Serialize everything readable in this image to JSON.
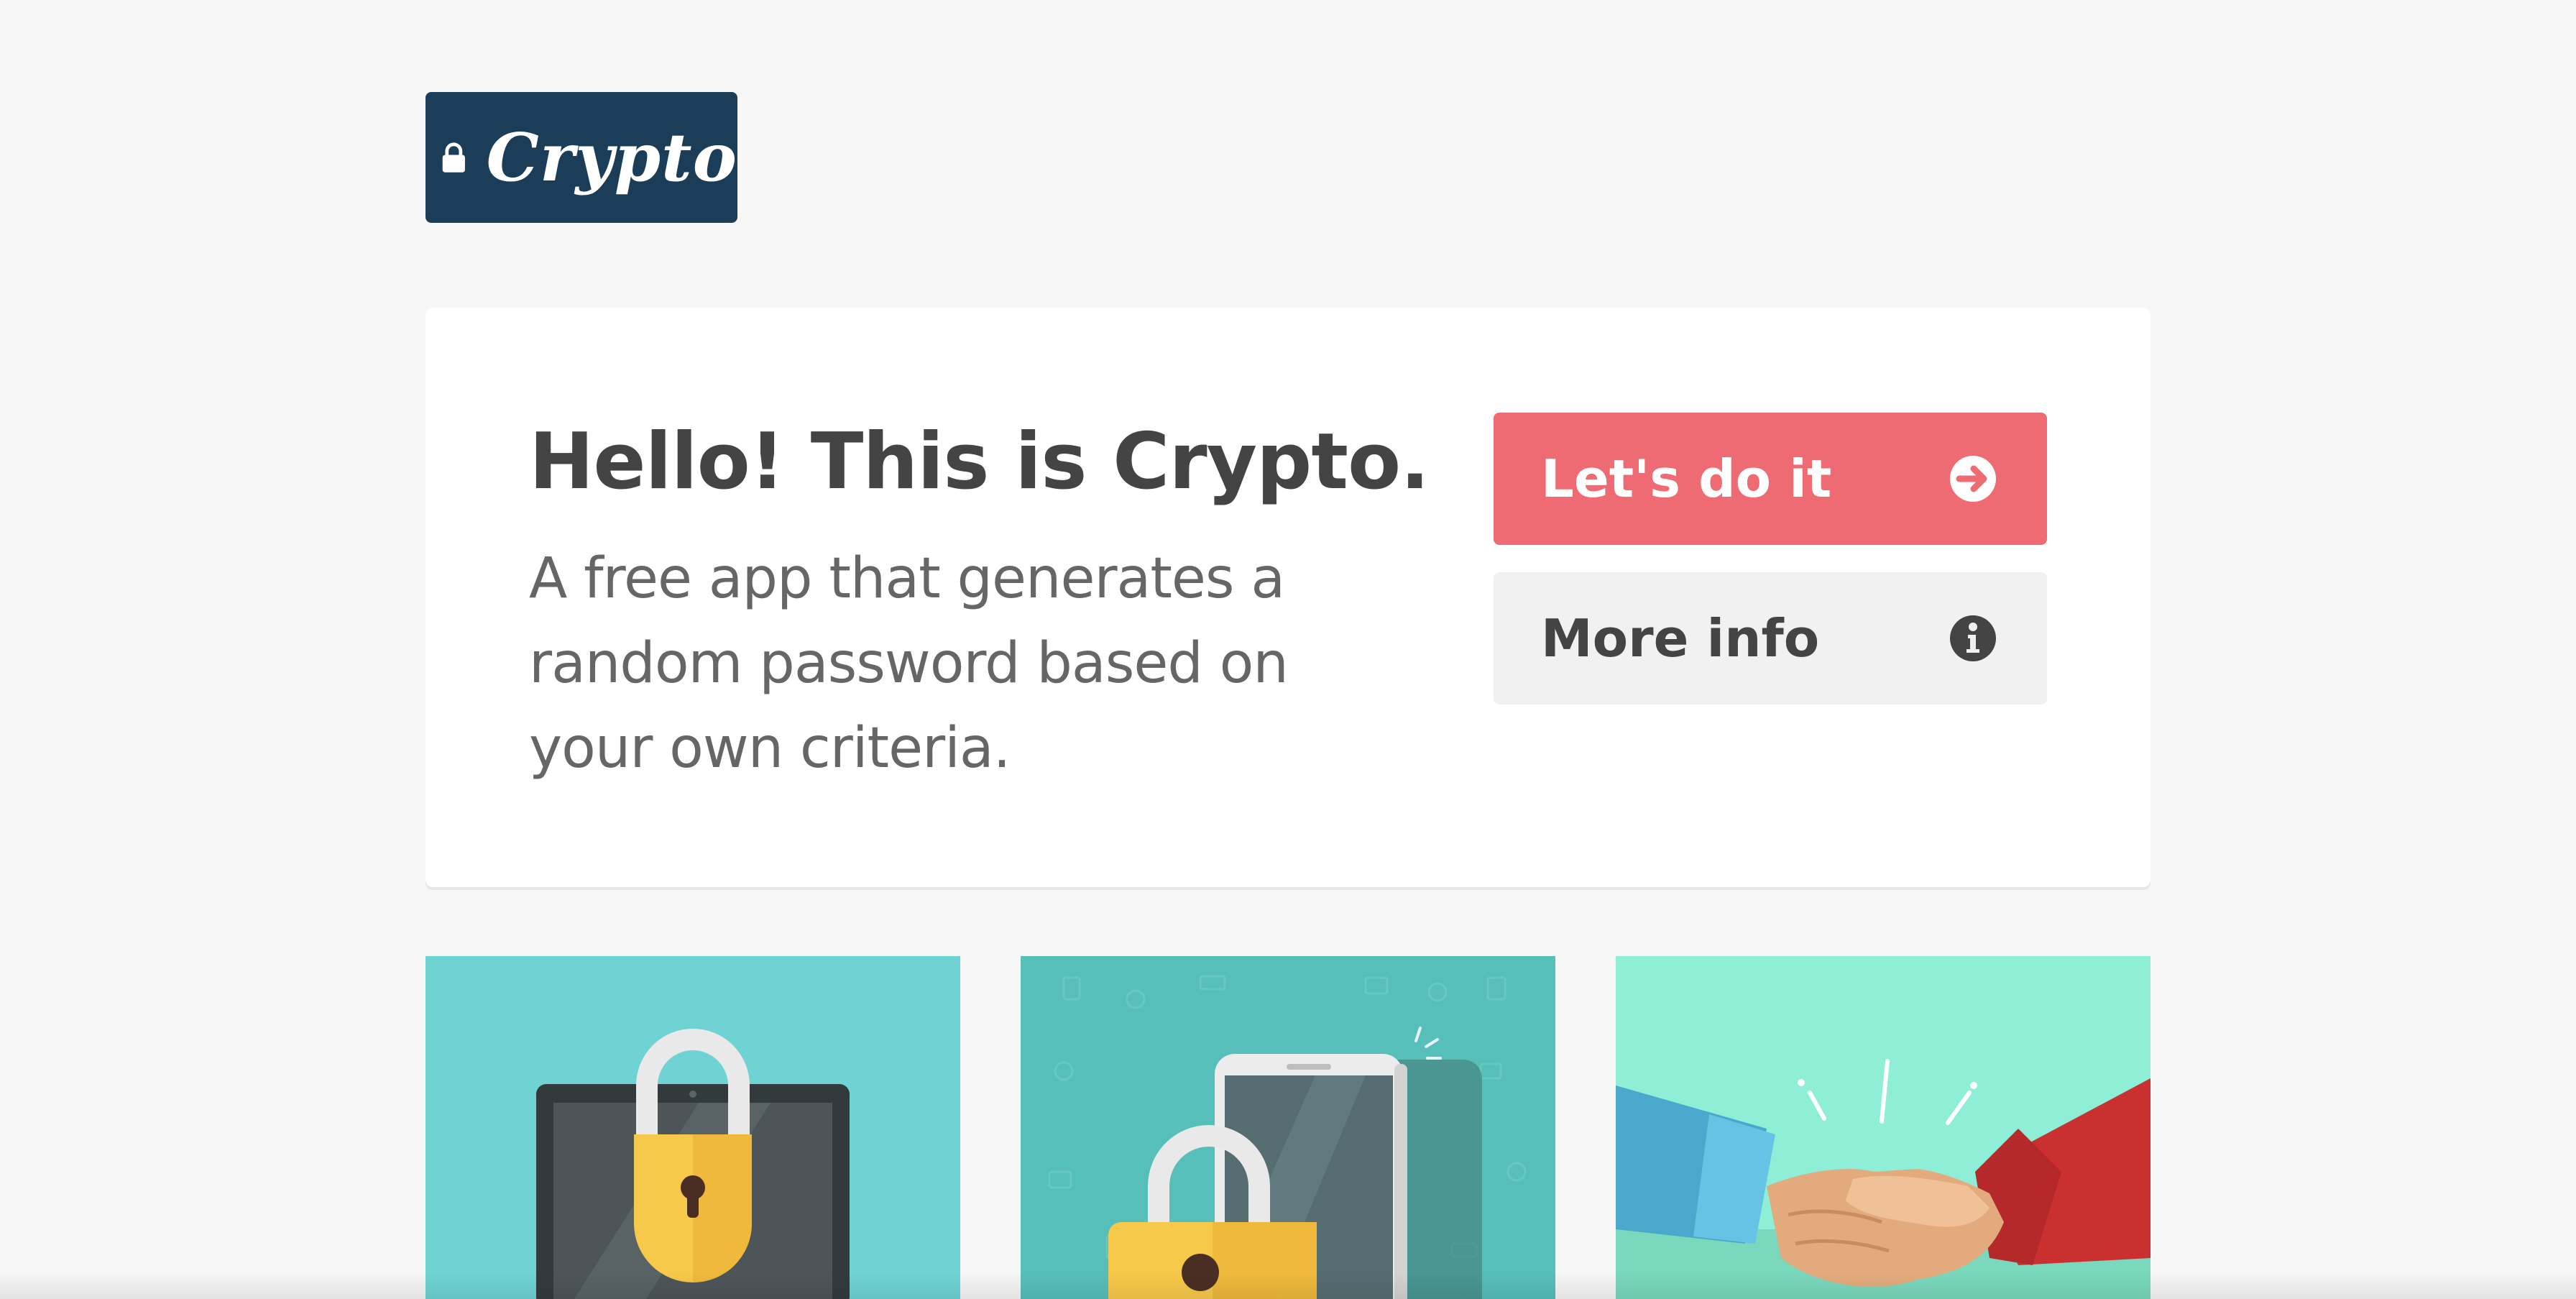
{
  "header": {
    "logo_text": "Crypto",
    "logo_icon": "lock-icon"
  },
  "hero": {
    "title": "Hello! This is Crypto.",
    "description": "A free app that generates a random password based on your own criteria."
  },
  "actions": {
    "primary_label": "Let's do it",
    "primary_icon": "arrow-right-circle-icon",
    "secondary_label": "More info",
    "secondary_icon": "info-circle-icon"
  },
  "tiles": [
    {
      "icon": "laptop-padlock-illustration"
    },
    {
      "icon": "phone-padlock-illustration"
    },
    {
      "icon": "handshake-illustration"
    }
  ],
  "colors": {
    "background": "#f6f6f6",
    "logo_bg": "#1c3d57",
    "primary": "#ef6b74",
    "secondary_bg": "#f1f1f1",
    "text_dark": "#444444",
    "text_muted": "#666666",
    "tile_1": "#6fd3d3",
    "tile_2": "#57bfba",
    "tile_3": "#8eeed6"
  }
}
